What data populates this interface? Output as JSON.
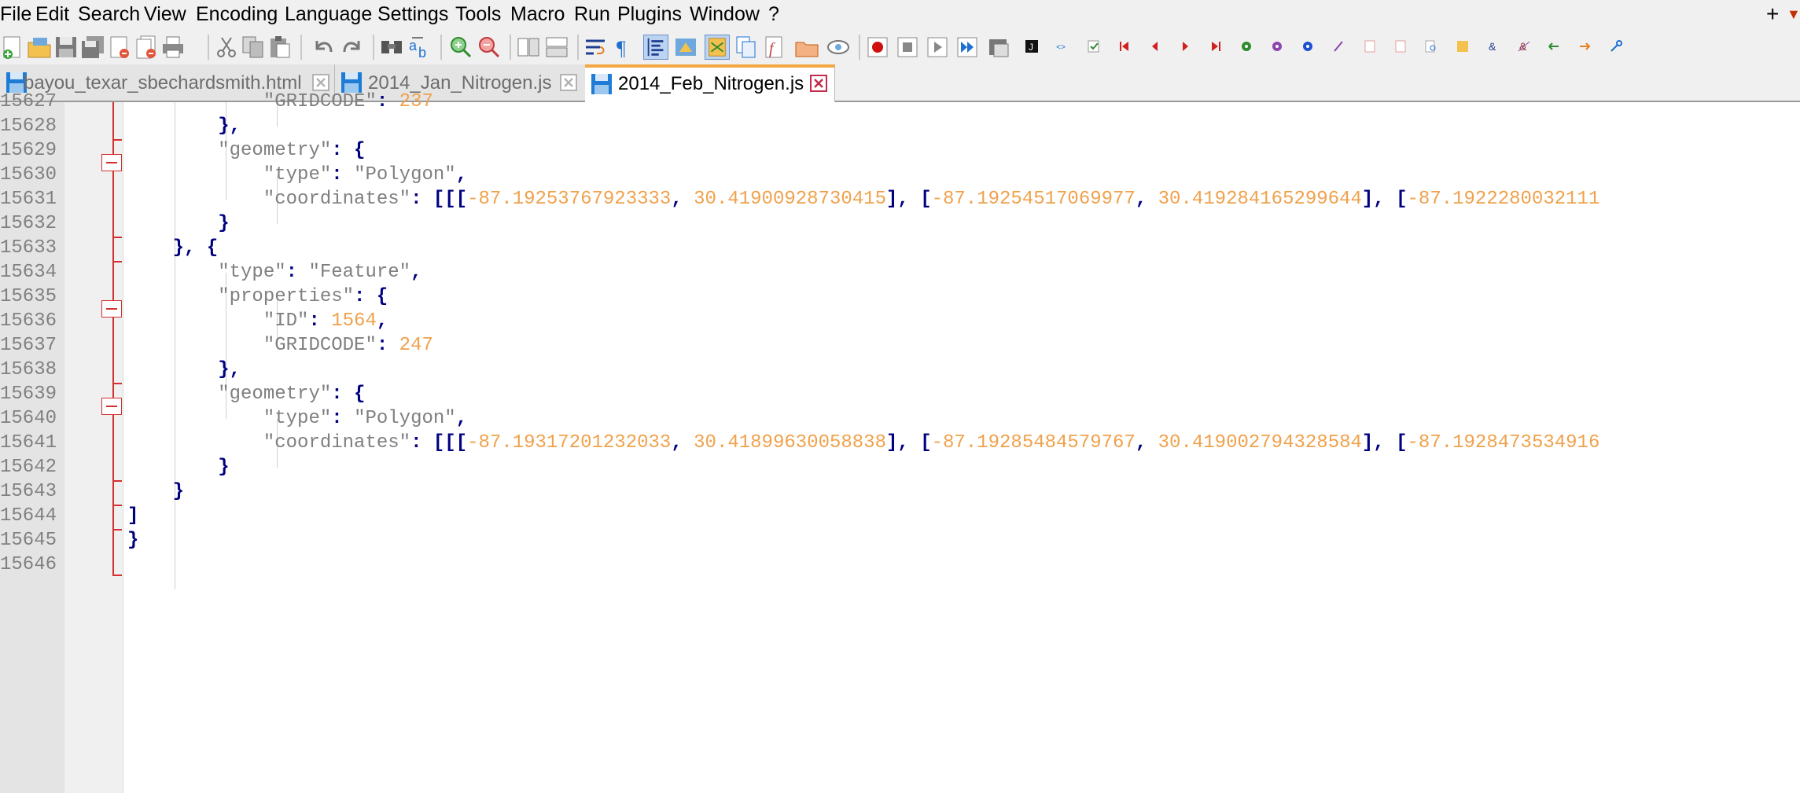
{
  "menu": [
    "File",
    "Edit",
    "Search",
    "View",
    "Encoding",
    "Language",
    "Settings",
    "Tools",
    "Macro",
    "Run",
    "Plugins",
    "Window",
    "?"
  ],
  "menu_extra": {
    "plus": "+",
    "arrow": "▼"
  },
  "tabs": [
    {
      "label": "bayou_texar_sbechardsmith.html",
      "active": false,
      "disk_color": "#1e7bd6"
    },
    {
      "label": "2014_Jan_Nitrogen.js",
      "active": false,
      "disk_color": "#1e7bd6"
    },
    {
      "label": "2014_Feb_Nitrogen.js",
      "active": true,
      "disk_color": "#1e7bd6"
    }
  ],
  "editor": {
    "lines": [
      {
        "num": "15627",
        "segments": [
          [
            "            ",
            ""
          ],
          [
            "\"GRIDCODE\"",
            "str"
          ],
          [
            ": ",
            "op"
          ],
          [
            "237",
            "num"
          ]
        ]
      },
      {
        "num": "15628",
        "segments": [
          [
            "        ",
            ""
          ],
          [
            "},",
            "op"
          ]
        ]
      },
      {
        "num": "15629",
        "segments": [
          [
            "        ",
            ""
          ],
          [
            "\"geometry\"",
            "str"
          ],
          [
            ": {",
            "op"
          ]
        ]
      },
      {
        "num": "15630",
        "segments": [
          [
            "            ",
            ""
          ],
          [
            "\"type\"",
            "str"
          ],
          [
            ": ",
            "op"
          ],
          [
            "\"Polygon\"",
            "str"
          ],
          [
            ",",
            "op"
          ]
        ]
      },
      {
        "num": "15631",
        "segments": [
          [
            "            ",
            ""
          ],
          [
            "\"coordinates\"",
            "str"
          ],
          [
            ": [[[",
            "op"
          ],
          [
            "-87.19253767923333",
            "num"
          ],
          [
            ", ",
            "op"
          ],
          [
            "30.41900928730415",
            "num"
          ],
          [
            "], [",
            "op"
          ],
          [
            "-87.19254517069977",
            "num"
          ],
          [
            ", ",
            "op"
          ],
          [
            "30.419284165299644",
            "num"
          ],
          [
            "], [",
            "op"
          ],
          [
            "-87.1922280032111",
            "num"
          ]
        ]
      },
      {
        "num": "15632",
        "segments": [
          [
            "        ",
            ""
          ],
          [
            "}",
            "op"
          ]
        ]
      },
      {
        "num": "15633",
        "segments": [
          [
            "    ",
            ""
          ],
          [
            "}, {",
            "op"
          ]
        ]
      },
      {
        "num": "15634",
        "segments": [
          [
            "        ",
            ""
          ],
          [
            "\"type\"",
            "str"
          ],
          [
            ": ",
            "op"
          ],
          [
            "\"Feature\"",
            "str"
          ],
          [
            ",",
            "op"
          ]
        ]
      },
      {
        "num": "15635",
        "segments": [
          [
            "        ",
            ""
          ],
          [
            "\"properties\"",
            "str"
          ],
          [
            ": {",
            "op"
          ]
        ]
      },
      {
        "num": "15636",
        "segments": [
          [
            "            ",
            ""
          ],
          [
            "\"ID\"",
            "str"
          ],
          [
            ": ",
            "op"
          ],
          [
            "1564",
            "num"
          ],
          [
            ",",
            "op"
          ]
        ]
      },
      {
        "num": "15637",
        "segments": [
          [
            "            ",
            ""
          ],
          [
            "\"GRIDCODE\"",
            "str"
          ],
          [
            ": ",
            "op"
          ],
          [
            "247",
            "num"
          ]
        ]
      },
      {
        "num": "15638",
        "segments": [
          [
            "        ",
            ""
          ],
          [
            "},",
            "op"
          ]
        ]
      },
      {
        "num": "15639",
        "segments": [
          [
            "        ",
            ""
          ],
          [
            "\"geometry\"",
            "str"
          ],
          [
            ": {",
            "op"
          ]
        ]
      },
      {
        "num": "15640",
        "segments": [
          [
            "            ",
            ""
          ],
          [
            "\"type\"",
            "str"
          ],
          [
            ": ",
            "op"
          ],
          [
            "\"Polygon\"",
            "str"
          ],
          [
            ",",
            "op"
          ]
        ]
      },
      {
        "num": "15641",
        "segments": [
          [
            "            ",
            ""
          ],
          [
            "\"coordinates\"",
            "str"
          ],
          [
            ": [[[",
            "op"
          ],
          [
            "-87.19317201232033",
            "num"
          ],
          [
            ", ",
            "op"
          ],
          [
            "30.41899630058838",
            "num"
          ],
          [
            "], [",
            "op"
          ],
          [
            "-87.19285484579767",
            "num"
          ],
          [
            ", ",
            "op"
          ],
          [
            "30.419002794328584",
            "num"
          ],
          [
            "], [",
            "op"
          ],
          [
            "-87.1928473534916",
            "num"
          ]
        ]
      },
      {
        "num": "15642",
        "segments": [
          [
            "        ",
            ""
          ],
          [
            "}",
            "op"
          ]
        ]
      },
      {
        "num": "15643",
        "segments": [
          [
            "    ",
            ""
          ],
          [
            "}",
            "op"
          ]
        ]
      },
      {
        "num": "15644",
        "segments": [
          [
            "",
            ""
          ],
          [
            "]",
            "op"
          ]
        ]
      },
      {
        "num": "15645",
        "segments": [
          [
            "",
            ""
          ],
          [
            "}",
            "op"
          ]
        ]
      },
      {
        "num": "15646",
        "segments": []
      }
    ]
  },
  "colors": {
    "string": "#7f7f7f",
    "number": "#f0a14b",
    "operator": "#000080",
    "fold": "#d32f2f",
    "active_tab_accent": "#f5a742"
  }
}
